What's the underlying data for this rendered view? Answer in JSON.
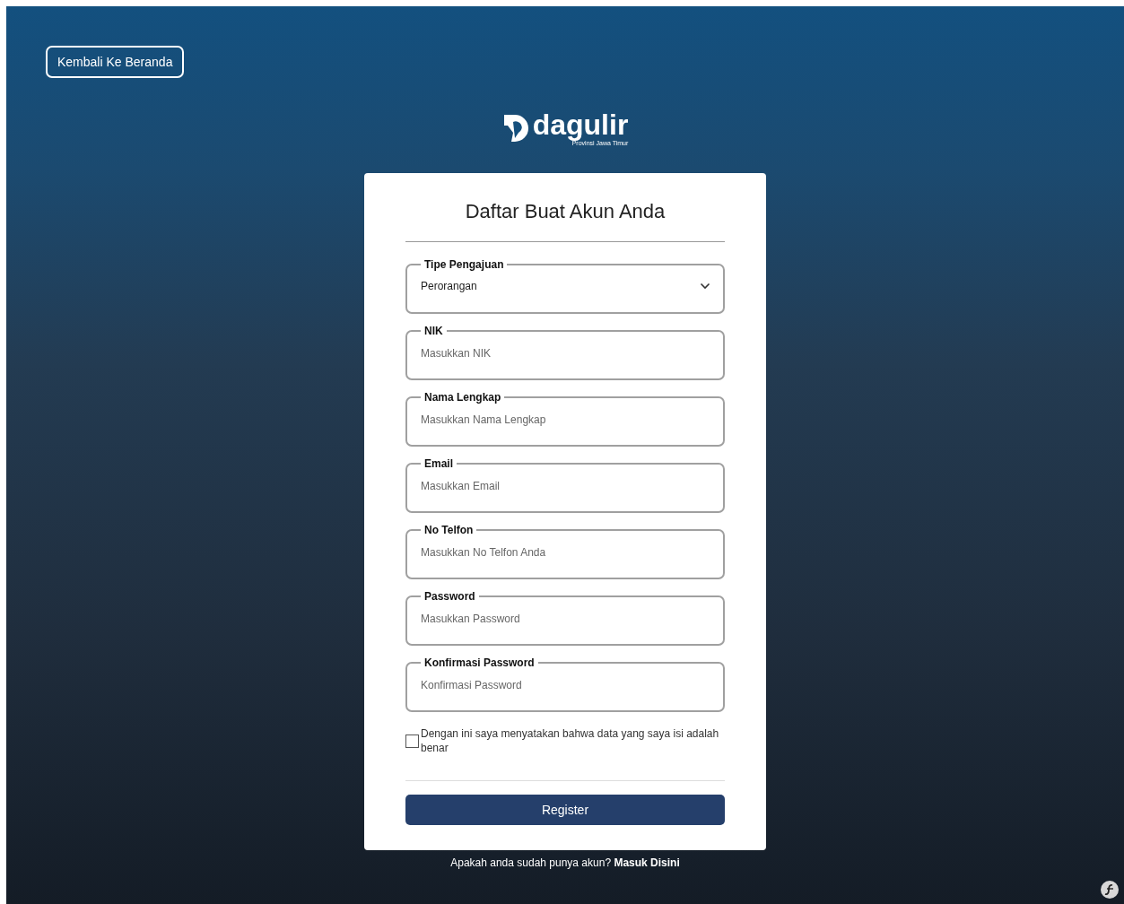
{
  "back_button": "Kembali Ke Beranda",
  "logo": {
    "name": "dagulir",
    "subtitle": "Provinsi Jawa Timur"
  },
  "form": {
    "title": "Daftar Buat Akun Anda",
    "fields": [
      {
        "kind": "select",
        "label": "Tipe Pengajuan",
        "value": "Perorangan"
      },
      {
        "kind": "input",
        "label": "NIK",
        "placeholder": "Masukkan NIK"
      },
      {
        "kind": "input",
        "label": "Nama Lengkap",
        "placeholder": "Masukkan Nama Lengkap"
      },
      {
        "kind": "input",
        "label": "Email",
        "placeholder": "Masukkan Email"
      },
      {
        "kind": "input",
        "label": "No Telfon",
        "placeholder": "Masukkan No Telfon Anda"
      },
      {
        "kind": "input",
        "label": "Password",
        "placeholder": "Masukkan Password"
      },
      {
        "kind": "input",
        "label": "Konfirmasi Password",
        "placeholder": "Konfirmasi Password"
      }
    ],
    "agreement": {
      "text": "Dengan ini saya menyatakan bahwa data yang saya isi adalah benar",
      "checked": false
    },
    "submit": "Register"
  },
  "login_prompt": {
    "text": "Apakah anda sudah punya akun?",
    "link": "Masuk Disini"
  }
}
